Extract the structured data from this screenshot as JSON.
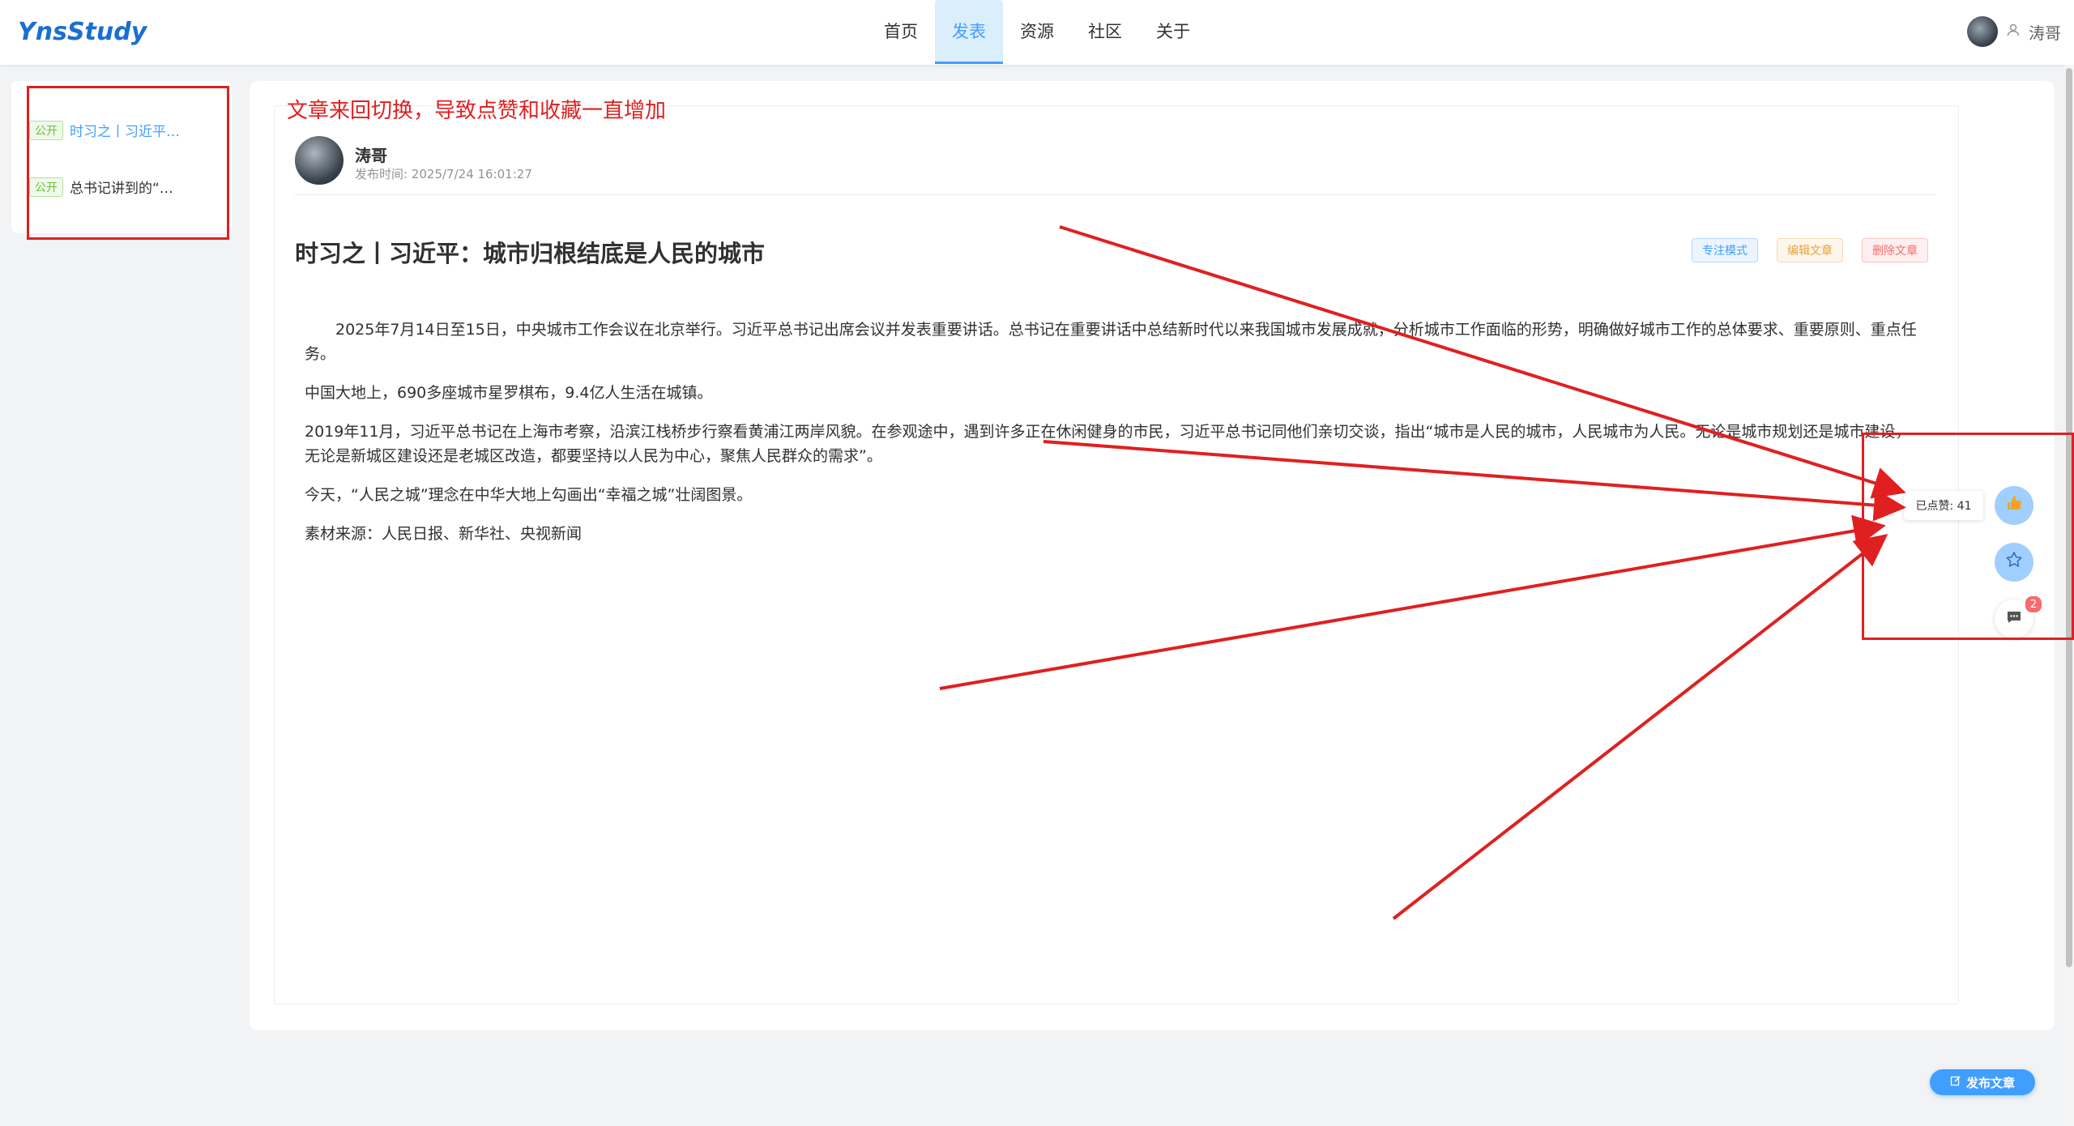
{
  "app": {
    "logo": "YnsStudy"
  },
  "nav": {
    "items": [
      "首页",
      "发表",
      "资源",
      "社区",
      "关于"
    ],
    "active_index": 1
  },
  "user": {
    "name": "涛哥"
  },
  "sidebar": {
    "items": [
      {
        "tag": "公开",
        "title": "时习之丨习近平…",
        "active": true
      },
      {
        "tag": "公开",
        "title": "总书记讲到的“…",
        "active": false
      }
    ]
  },
  "annotation": {
    "text": "文章来回切换，导致点赞和收藏一直增加"
  },
  "article": {
    "author": "涛哥",
    "publish_time": "发布时间: 2025/7/24 16:01:27",
    "title": "时习之丨习近平：城市归根结底是人民的城市",
    "buttons": {
      "focus": "专注模式",
      "edit": "编辑文章",
      "delete": "删除文章"
    },
    "paragraphs": [
      "2025年7月14日至15日，中央城市工作会议在北京举行。习近平总书记出席会议并发表重要讲话。总书记在重要讲话中总结新时代以来我国城市发展成就，分析城市工作面临的形势，明确做好城市工作的总体要求、重要原则、重点任务。",
      "中国大地上，690多座城市星罗棋布，9.4亿人生活在城镇。",
      "2019年11月，习近平总书记在上海市考察，沿滨江栈桥步行察看黄浦江两岸风貌。在参观途中，遇到许多正在休闲健身的市民，习近平总书记同他们亲切交谈，指出“城市是人民的城市，人民城市为人民。无论是城市规划还是城市建设，无论是新城区建设还是老城区改造，都要坚持以人民为中心，聚焦人民群众的需求”。",
      "今天，“人民之城”理念在中华大地上勾画出“幸福之城”壮阔图景。",
      "素材来源：人民日报、新华社、央视新闻"
    ]
  },
  "actions": {
    "like_label": "已点赞: 41",
    "comment_badge": "2",
    "icons": {
      "like": "thumbs-up-icon",
      "star": "star-icon",
      "comment": "comment-icon"
    }
  },
  "publish_button": {
    "label": "发布文章"
  },
  "colors": {
    "accent": "#409eff",
    "annotation_red": "#e02020",
    "public_tag": "#67c23a"
  }
}
